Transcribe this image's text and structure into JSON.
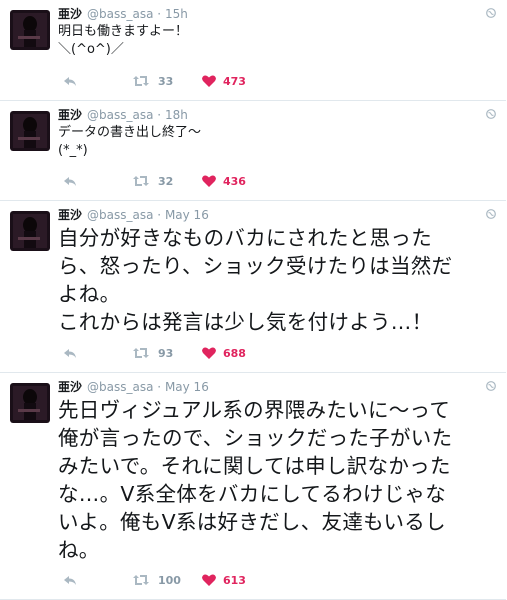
{
  "colors": {
    "like": "#e0245e",
    "muted": "#8899a6",
    "divider": "#e1e8ed"
  },
  "tweets": [
    {
      "name": "亜沙",
      "handle": "@bass_asa",
      "separator": "·",
      "time": "15h",
      "lines": [
        "明日も働きますよー！",
        "＼(^o^)／"
      ],
      "retweets": "33",
      "likes": "473"
    },
    {
      "name": "亜沙",
      "handle": "@bass_asa",
      "separator": "·",
      "time": "18h",
      "lines": [
        "データの書き出し終了〜",
        "(*_*)"
      ],
      "retweets": "32",
      "likes": "436"
    },
    {
      "name": "亜沙",
      "handle": "@bass_asa",
      "separator": "·",
      "time": "May 16",
      "lines": [
        "自分が好きなものバカにされたと思った",
        "ら、怒ったり、ショック受けたりは当然だ",
        "よね。",
        "これからは発言は少し気を付けよう…！"
      ],
      "retweets": "93",
      "likes": "688"
    },
    {
      "name": "亜沙",
      "handle": "@bass_asa",
      "separator": "·",
      "time": "May 16",
      "lines": [
        "先日ヴィジュアル系の界隈みたいに〜って",
        "俺が言ったので、ショックだった子がいた",
        "みたいで。それに関しては申し訳なかった",
        "な…。V系全体をバカにしてるわけじゃな",
        "いよ。俺もV系は好きだし、友達もいるし",
        "ね。"
      ],
      "retweets": "100",
      "likes": "613"
    }
  ]
}
